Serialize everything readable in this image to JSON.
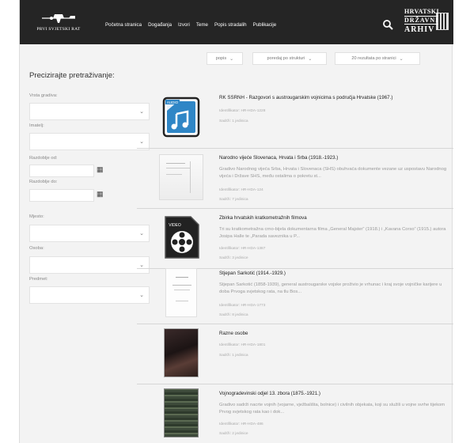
{
  "header": {
    "logo_text": "PRVI SVJETSKI RAT",
    "nav": [
      "Početna stranica",
      "Događanja",
      "Izvori",
      "Teme",
      "Popis stradalih",
      "Publikacije"
    ],
    "hda": {
      "line1": "HRVATSKI",
      "line2": "DRŽAVNI",
      "line3": "ARHIV"
    }
  },
  "sortbar": {
    "view": "popis",
    "order": "poredaj po strukturi",
    "per_page": "20 rezultata po stranici"
  },
  "sidebar": {
    "title": "Precizirajte pretraživanje:",
    "vrsta": "Vrsta gradiva:",
    "imatelj": "Imatelj:",
    "od": "Razdoblje od:",
    "do": "Razdoblje do:",
    "mjesto": "Mjesto:",
    "osoba": "Osoba:",
    "predmet": "Predmet:"
  },
  "results": [
    {
      "title": "RK SSRNH - Razgovori s austrougarskim vojnicima s područja Hrvatske   (1967.)",
      "desc": "",
      "id": "Identifikator: HR-HDA-1228",
      "sadrzi": "Sadrži:   1 jedinica",
      "thumb": "audio-icon"
    },
    {
      "title": "Narodno vijeće Slovenaca, Hrvata i Srba   (1918.-1923.)",
      "desc": "Gradivo Narodnog vijeća Srba, Hrvata i Slovenaca (SHS) obuhvaća dokumente vezane uz uspostavu Narodnog vijeća i Države SHS, među ostalima o pokretu st...",
      "id": "Identifikator: HR-HDA-124",
      "sadrzi": "Sadrži:   7 jedinica",
      "thumb": "document-photo"
    },
    {
      "title": "Zbirka hrvatskih kratkometražnih filmova",
      "desc": "Tri su kratkometražna crno-bijela dokumentarna filma „General Majster“ (1918.) i „Kavana Corso“ (1915.) autora Josipa Halle te „Parada saveznika u P...",
      "id": "Identifikator: HR-HDA-1387",
      "sadrzi": "Sadrži:   3 jedinice",
      "thumb": "video-icon"
    },
    {
      "title": "Stjepan Sarkotić   (1914.-1929.)",
      "desc": "Stjepan Sarkotić (1858-1939), general austrougarske vojske proživio je vrhunac i kraj svoje vojničke karijere u doba Prvoga svjetskog rata, na tlu Bos...",
      "id": "Identifikator: HR-HDA-1773",
      "sadrzi": "Sadrži:   8 jedinica",
      "thumb": "document-photo"
    },
    {
      "title": "Razne osobe",
      "desc": "",
      "id": "Identifikator: HR-HDA-1801",
      "sadrzi": "Sadrži:   1 jedinica",
      "thumb": "portrait-photo"
    },
    {
      "title": "Vojnogradevinski odjel 13. zbora   (1875.-1921.)",
      "desc": "Gradivo sadrži nacrte vojnih (vojarne, vježbališta, bolnice) i civilnih objekata, koji su služili u vojne svrhe tijekom Prvog svjetskog rata kao i dok...",
      "id": "Identifikator: HR-HDA-486",
      "sadrzi": "Sadrži:   2 jedinice",
      "thumb": "book-photo"
    }
  ]
}
